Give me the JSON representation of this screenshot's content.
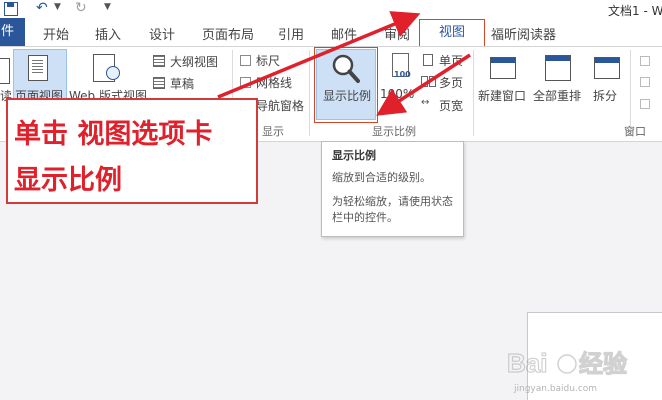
{
  "titlebar": {
    "document_title": "文档1 - W"
  },
  "tabs": {
    "file": "件",
    "home": "开始",
    "insert": "插入",
    "design": "设计",
    "page_layout": "页面布局",
    "references": "引用",
    "mailings": "邮件",
    "review": "审阅",
    "view": "视图",
    "foxit_reader": "福昕阅读器"
  },
  "ribbon": {
    "views": {
      "read_mode": "读",
      "print_layout": "页面视图",
      "web_layout": "Web 版式视图",
      "outline": "大纲视图",
      "draft": "草稿"
    },
    "show": {
      "label": "显示",
      "ruler": "标尺",
      "gridlines": "网格线",
      "navigation_pane": "导航窗格"
    },
    "zoom": {
      "label": "显示比例",
      "zoom_button": "显示比例",
      "hundred_percent": "100%",
      "one_page": "单页",
      "multiple_pages": "多页",
      "page_width": "页宽"
    },
    "window": {
      "label": "窗口",
      "new_window": "新建窗口",
      "arrange_all": "全部重排",
      "split": "拆分"
    }
  },
  "tooltip": {
    "title": "显示比例",
    "description": "缩放到合适的级别。",
    "hint": "为轻松缩放，请使用状态栏中的控件。"
  },
  "annotation": {
    "line1": "单击 视图选项卡",
    "line2": "显示比例"
  },
  "colors": {
    "accent": "#2b579a",
    "highlight": "#cde0f6",
    "annotation_red": "#e0202a"
  },
  "icons": {
    "save": "save-icon",
    "undo": "undo-icon",
    "redo": "redo-icon",
    "zoom": "magnifier-icon"
  }
}
